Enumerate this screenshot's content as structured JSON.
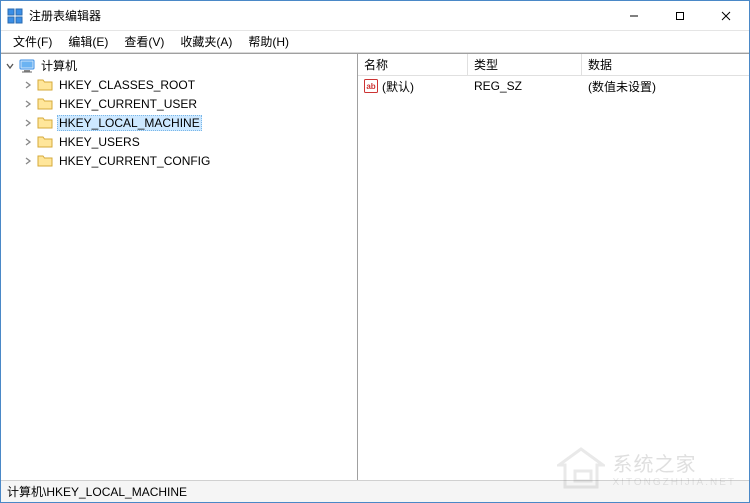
{
  "window": {
    "title": "注册表编辑器"
  },
  "menu": {
    "file": "文件(F)",
    "edit": "编辑(E)",
    "view": "查看(V)",
    "favorites": "收藏夹(A)",
    "help": "帮助(H)"
  },
  "tree": {
    "root_label": "计算机",
    "keys": {
      "classes_root": "HKEY_CLASSES_ROOT",
      "current_user": "HKEY_CURRENT_USER",
      "local_machine": "HKEY_LOCAL_MACHINE",
      "users": "HKEY_USERS",
      "current_config": "HKEY_CURRENT_CONFIG"
    }
  },
  "list": {
    "headers": {
      "name": "名称",
      "type": "类型",
      "data": "数据"
    },
    "rows": [
      {
        "name": "(默认)",
        "type": "REG_SZ",
        "data": "(数值未设置)"
      }
    ]
  },
  "statusbar": {
    "path": "计算机\\HKEY_LOCAL_MACHINE"
  },
  "icons": {
    "app": "regedit-icon",
    "computer": "computer-icon",
    "folder": "folder-icon",
    "string_value": "ab-icon"
  }
}
